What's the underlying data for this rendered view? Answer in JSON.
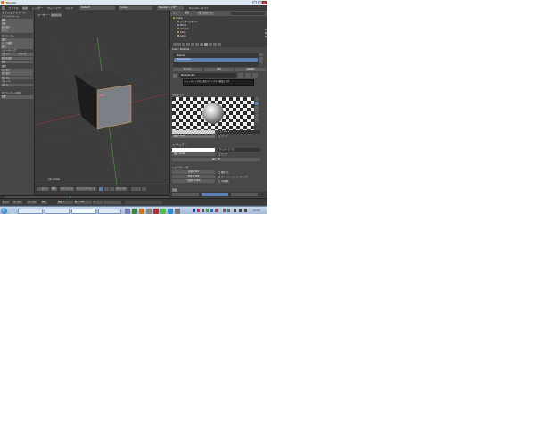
{
  "window": {
    "title": "Blender"
  },
  "menubar": {
    "items": [
      "ファイル",
      "追加",
      "レンダー",
      "ウィンドウ",
      "ヘルプ"
    ],
    "screen": "Default",
    "scene": "Scene",
    "engine": "Blender レンダー",
    "stats": "Blender v2.64"
  },
  "toolshelf": {
    "header": "オブジェクトツール",
    "section_transform": "トランスフォーム",
    "buttons": [
      "移動",
      "回転",
      "拡大縮小",
      "ミラー",
      "複製",
      "リンク複製",
      "結合",
      "ミックス",
      "フラット",
      "円滑化",
      "スムーズ",
      "原点を設定",
      "削除",
      "ベイク"
    ],
    "history_label": "履歴",
    "groups_label": "グループ",
    "footer_label": "オブジェクトの追加",
    "footer_btn": "位置"
  },
  "viewport": {
    "label": "ユーザー・透視投影",
    "object_name": "(1) Cube"
  },
  "view_header": {
    "buttons": [
      "ビュー",
      "選択",
      "オブジェクト",
      "オブジェクトモード",
      "グローバル"
    ]
  },
  "timeline": {
    "labels": [
      "ビュー",
      "マーカー",
      "フレーム",
      "再生"
    ],
    "start": "開始: 1",
    "end": "終了: 250",
    "current": "1"
  },
  "outliner": {
    "tabs": [
      "ビュー",
      "検索",
      "全てのシーン"
    ],
    "rows": [
      "Scene",
      "レンダーレイヤー",
      "World",
      "Camera",
      "Cube",
      "Lamp"
    ]
  },
  "properties": {
    "breadcrumb": [
      "Cube",
      "Material"
    ],
    "slots": [
      "Material",
      "Material.001"
    ],
    "assign": [
      "割り当て",
      "選択",
      "選択解除"
    ],
    "material_name": "Material.001",
    "tooltip": "シェーディングのためのマテリアルを追加します",
    "preview_label": "プレビュー",
    "diffuse_label": "ディフューズ",
    "diffuse_shader": "ランバート",
    "intensity": "強度: 0.800",
    "ramp": "ランプ",
    "specular_label": "スペキュラー",
    "specular_shader": "クックトランス",
    "specular_intensity": "強度: 0.500",
    "hardness": "硬さ: 50",
    "shading_label": "シェーディング",
    "emit": "放射: 0.00",
    "ambient": "環境: 1.000",
    "translucency": "半透明: 0.000",
    "shadeless": "陰影なし",
    "tangent": "タンジェントシェーディング",
    "cubic": "3次補間",
    "transparency_label": "透過"
  },
  "statusbar": {
    "buttons": [
      "ビュー",
      "マーカー",
      "フレーム",
      "再生"
    ],
    "frame": "開始: 1",
    "end": "終了: 250"
  },
  "taskbar": {
    "clock": "22:00"
  },
  "colors": {
    "accent": "#5e7fb2",
    "diffuse": "#cfcfcf",
    "specular": "#ffffff",
    "grid_x": "#9b3c3c",
    "grid_y": "#5c9a3a"
  }
}
